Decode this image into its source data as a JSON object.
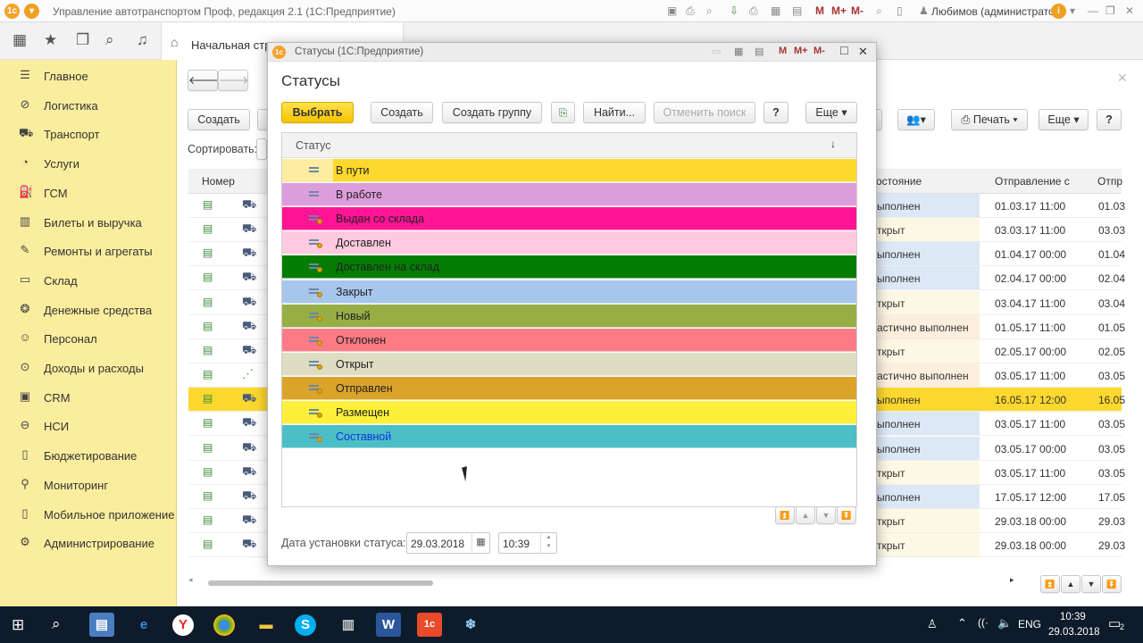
{
  "app": {
    "title": "Управление автотранспортом Проф, редакция 2.1  (1С:Предприятие)",
    "user": "Любимов (администратор)",
    "home_tab": "Начальная стра"
  },
  "sidebar": {
    "items": [
      {
        "label": "Главное",
        "icon": "menu-icon"
      },
      {
        "label": "Логистика",
        "icon": "compass-icon"
      },
      {
        "label": "Транспорт",
        "icon": "truck-icon"
      },
      {
        "label": "Услуги",
        "icon": "services-icon"
      },
      {
        "label": "ГСМ",
        "icon": "fuel-icon"
      },
      {
        "label": "Билеты и выручка",
        "icon": "tickets-icon"
      },
      {
        "label": "Ремонты и агрегаты",
        "icon": "wrench-icon"
      },
      {
        "label": "Склад",
        "icon": "warehouse-icon"
      },
      {
        "label": "Денежные средства",
        "icon": "money-icon"
      },
      {
        "label": "Персонал",
        "icon": "person-icon"
      },
      {
        "label": "Доходы и расходы",
        "icon": "income-icon"
      },
      {
        "label": "CRM",
        "icon": "crm-icon"
      },
      {
        "label": "НСИ",
        "icon": "reference-icon"
      },
      {
        "label": "Бюджетирование",
        "icon": "budget-icon"
      },
      {
        "label": "Мониторинг",
        "icon": "monitoring-icon"
      },
      {
        "label": "Мобильное приложение",
        "icon": "mobile-icon"
      },
      {
        "label": "Администрирование",
        "icon": "gear-icon"
      }
    ]
  },
  "background": {
    "create_label": "Создать",
    "sort_label": "Сортировать:",
    "print_label": "Печать",
    "more_label": "Еще",
    "help_label": "?",
    "columns": {
      "number": "Номер",
      "state": "остояние",
      "departure": "Отправление с",
      "departure2": "Отпр"
    },
    "rows": [
      {
        "state": "ыполнен",
        "departure": "01.03.17 11:00",
        "dep2": "01.03"
      },
      {
        "state": "ткрыт",
        "departure": "03.03.17 11:00",
        "dep2": "03.03"
      },
      {
        "state": "ыполнен",
        "departure": "01.04.17 00:00",
        "dep2": "01.04"
      },
      {
        "state": "ыполнен",
        "departure": "02.04.17 00:00",
        "dep2": "02.04"
      },
      {
        "state": "ткрыт",
        "departure": "03.04.17 11:00",
        "dep2": "03.04"
      },
      {
        "state": "астично выполнен",
        "departure": "01.05.17 11:00",
        "dep2": "01.05"
      },
      {
        "state": "ткрыт",
        "departure": "02.05.17 00:00",
        "dep2": "02.05"
      },
      {
        "state": "астично выполнен",
        "departure": "03.05.17 11:00",
        "dep2": "03.05"
      },
      {
        "state": "ыполнен",
        "departure": "16.05.17 12:00",
        "dep2": "16.05"
      },
      {
        "state": "ыполнен",
        "departure": "03.05.17 11:00",
        "dep2": "03.05"
      },
      {
        "state": "ыполнен",
        "departure": "03.05.17 00:00",
        "dep2": "03.05"
      },
      {
        "state": "ткрыт",
        "departure": "03.05.17 11:00",
        "dep2": "03.05"
      },
      {
        "state": "ыполнен",
        "departure": "17.05.17 12:00",
        "dep2": "17.05"
      },
      {
        "state": "ткрыт",
        "departure": "29.03.18 00:00",
        "dep2": "29.03"
      },
      {
        "state": "ткрыт",
        "departure": "29.03.18 00:00",
        "dep2": "29.03"
      }
    ]
  },
  "dialog": {
    "window_title": "Статусы  (1С:Предприятие)",
    "heading": "Статусы",
    "buttons": {
      "select": "Выбрать",
      "create": "Создать",
      "create_group": "Создать группу",
      "find": "Найти...",
      "cancel_search": "Отменить поиск",
      "help": "?",
      "more": "Еще"
    },
    "column_header": "Статус",
    "statuses": [
      {
        "label": "В пути",
        "color": "#fcd82e",
        "text_color": "#222222"
      },
      {
        "label": "В работе",
        "color": "#dd9ddc",
        "text_color": "#222222"
      },
      {
        "label": "Выдан со склада",
        "color": "#ff1493",
        "text_color": "#222222"
      },
      {
        "label": "Доставлен",
        "color": "#ffc9df",
        "text_color": "#222222"
      },
      {
        "label": "Доставлен на склад",
        "color": "#057d05",
        "text_color": "#222222"
      },
      {
        "label": "Закрыт",
        "color": "#a7c6ec",
        "text_color": "#222222"
      },
      {
        "label": "Новый",
        "color": "#97ae45",
        "text_color": "#222222"
      },
      {
        "label": "Отклонен",
        "color": "#fc7b85",
        "text_color": "#222222"
      },
      {
        "label": "Открыт",
        "color": "#dedcc2",
        "text_color": "#222222"
      },
      {
        "label": "Отправлен",
        "color": "#daa32a",
        "text_color": "#222222"
      },
      {
        "label": "Размещен",
        "color": "#fdf03a",
        "text_color": "#222222"
      },
      {
        "label": "Составной",
        "color": "#4cbec5",
        "text_color": "#1133dd"
      }
    ],
    "date_label": "Дата установки статуса:",
    "date_value": "29.03.2018",
    "time_value": "10:39"
  },
  "taskbar": {
    "lang": "ENG",
    "time": "10:39",
    "date": "29.03.2018",
    "notifications": "2"
  }
}
